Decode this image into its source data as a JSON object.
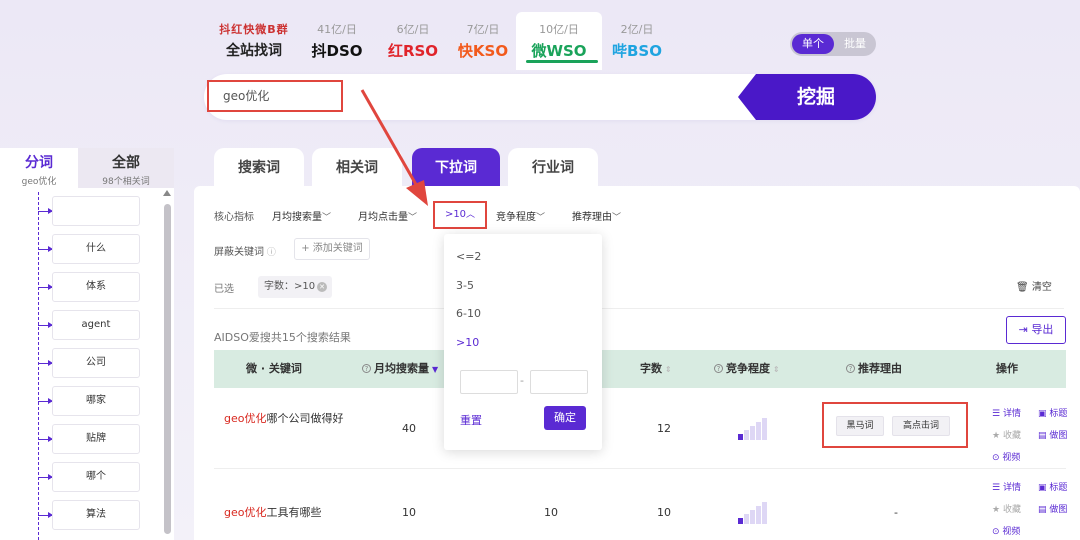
{
  "platforms": [
    {
      "sub": "抖红快微B群",
      "name": "全站找词"
    },
    {
      "sub": "41亿/日",
      "prefix": "抖",
      "name": "DSO"
    },
    {
      "sub": "6亿/日",
      "prefix": "红",
      "name": "RSO"
    },
    {
      "sub": "7亿/日",
      "prefix": "快",
      "name": "KSO"
    },
    {
      "sub": "10亿/日",
      "prefix": "微",
      "name": "WSO"
    },
    {
      "sub": "2亿/日",
      "prefix": "哔",
      "name": "BSO"
    }
  ],
  "toggle": {
    "single": "单个",
    "batch": "批量"
  },
  "search": {
    "value": "geo优化",
    "button": "挖掘"
  },
  "left_panel": {
    "tab_active": {
      "title": "分词",
      "sub": "geo优化"
    },
    "tab_other": {
      "title": "全部",
      "sub": "98个相关词"
    },
    "items": [
      "",
      "什么",
      "体系",
      "agent",
      "公司",
      "哪家",
      "贴牌",
      "哪个",
      "算法"
    ]
  },
  "main_tabs": [
    "搜索词",
    "相关词",
    "下拉词",
    "行业词"
  ],
  "filters": {
    "core_label": "核心指标",
    "avg_search": "月均搜索量",
    "avg_click": "月均点击量",
    "char_count": ">10",
    "competition": "竞争程度",
    "reason": "推荐理由",
    "block_label": "屏蔽关键词",
    "add_keyword": "添加关键词",
    "selected_label": "已选",
    "selected_chip": "字数：>10",
    "clear": "清空"
  },
  "result_count": "AIDSO爱搜共15个搜索结果",
  "export": "导出",
  "table": {
    "headers": {
      "keyword": "微 · 关键词",
      "avg_search": "月均搜索量",
      "chars": "字数",
      "competition": "竞争程度",
      "reason": "推荐理由",
      "ops": "操作"
    },
    "rows": [
      {
        "kw_hl": "geo优化",
        "kw_rest": "哪个公司做得好",
        "search": "40",
        "clicks": "",
        "chars": "12",
        "competition_level": 1,
        "tags": [
          "黑马词",
          "高点击词"
        ]
      },
      {
        "kw_hl": "geo优化",
        "kw_rest": "工具有哪些",
        "search": "10",
        "clicks": "10",
        "chars": "10",
        "competition_level": 1,
        "reason_text": "-"
      }
    ],
    "ops": {
      "detail": "详情",
      "title": "标题",
      "collect": "收藏",
      "cover": "做图",
      "video": "视频"
    }
  },
  "dropdown": {
    "options": [
      "<=2",
      "3-5",
      "6-10",
      ">10"
    ],
    "selected": ">10",
    "dash": "-",
    "reset": "重置",
    "confirm": "确定"
  },
  "colors": {
    "accent": "#5a2ad3",
    "highlight": "#d8281f",
    "annotation": "#e0463e",
    "header_bg": "#d8ebe1"
  }
}
